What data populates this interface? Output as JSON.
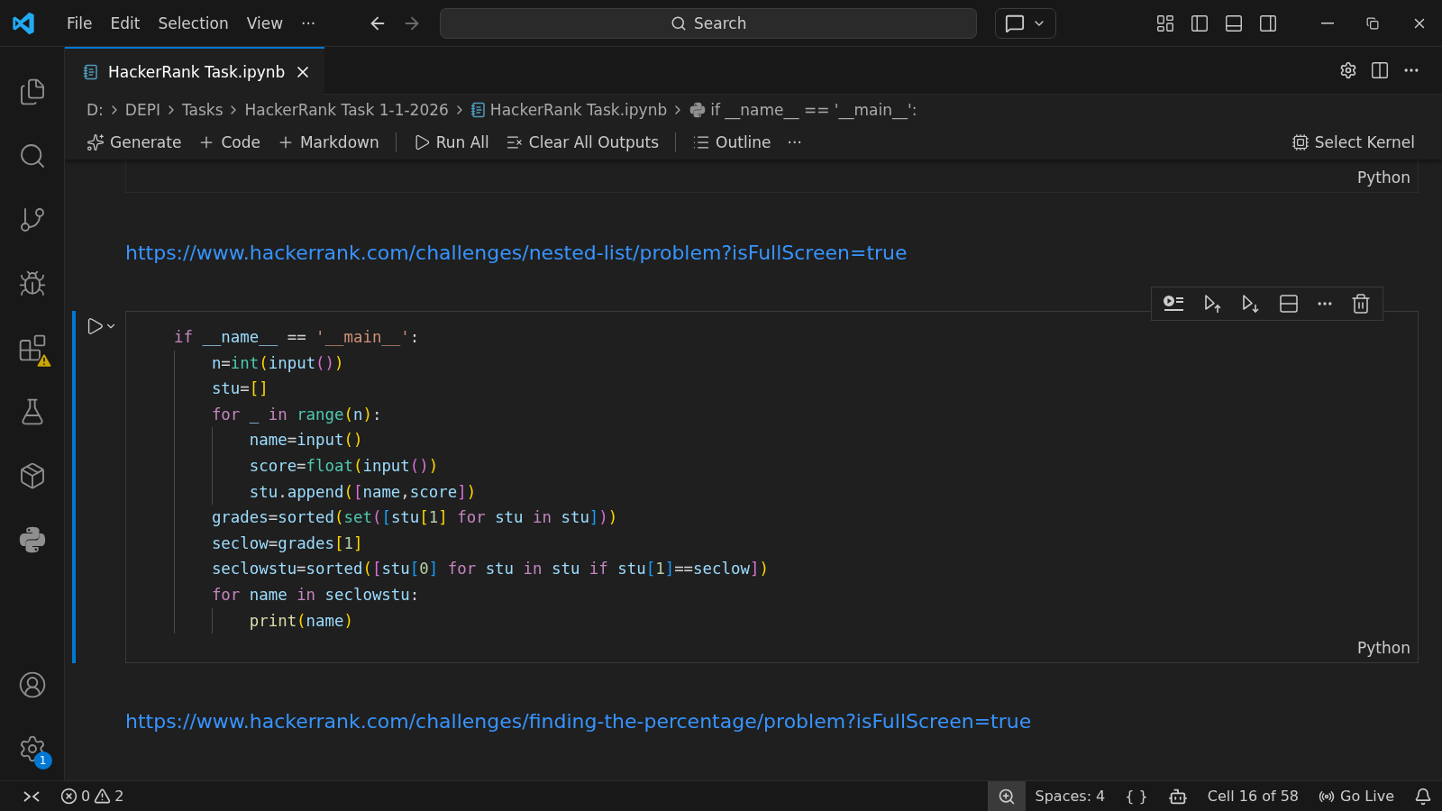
{
  "menu": [
    "File",
    "Edit",
    "Selection",
    "View",
    "···"
  ],
  "search": {
    "placeholder": "Search"
  },
  "activity_bar": [
    {
      "kind": "explorer",
      "warning": false
    },
    {
      "kind": "search",
      "warning": false
    },
    {
      "kind": "source-control",
      "warning": false
    },
    {
      "kind": "run",
      "warning": false
    },
    {
      "kind": "extensions",
      "warning": true
    },
    {
      "kind": "testing",
      "warning": false
    },
    {
      "kind": "package",
      "warning": false
    },
    {
      "kind": "python",
      "warning": false
    }
  ],
  "activity_bar_bottom": [
    {
      "kind": "account"
    },
    {
      "kind": "settings",
      "badge": "1"
    }
  ],
  "tabs": [
    {
      "label": "HackerRank Task.ipynb",
      "selected": true
    }
  ],
  "breadcrumbs": [
    {
      "label": "D:",
      "kind": "folder"
    },
    {
      "label": "DEPI",
      "kind": "folder"
    },
    {
      "label": "Tasks",
      "kind": "folder"
    },
    {
      "label": "HackerRank Task 1-1-2026",
      "kind": "folder"
    },
    {
      "label": "HackerRank Task.ipynb",
      "kind": "notebook"
    },
    {
      "label": "if __name__ == '__main__':",
      "kind": "python"
    }
  ],
  "toolbar": [
    {
      "label": "Generate",
      "kind": "sparkle"
    },
    {
      "label": "Code",
      "kind": "plus"
    },
    {
      "label": "Markdown",
      "kind": "plus"
    },
    {
      "kind": "divider"
    },
    {
      "label": "Run All",
      "kind": "run"
    },
    {
      "label": "Clear All Outputs",
      "kind": "clear"
    },
    {
      "kind": "divider"
    },
    {
      "label": "Outline",
      "kind": "list"
    },
    {
      "label": "···",
      "kind": "more"
    }
  ],
  "kernel": "Select Kernel",
  "cells": [
    {
      "kind": "code-tail",
      "language": "Python",
      "focused": false
    },
    {
      "kind": "markdown",
      "link": "https://www.hackerrank.com/challenges/nested-list/problem?isFullScreen=true"
    },
    {
      "kind": "code",
      "language": "Python",
      "focused": true,
      "lines": [
        {
          "tokens": [
            {
              "kind": "kw",
              "text": "if"
            },
            {
              "kind": "var",
              "text": " __name__"
            },
            {
              "kind": "p",
              "text": " == "
            },
            {
              "kind": "str",
              "text": "'__main__'"
            },
            {
              "kind": "p",
              "text": ":"
            }
          ],
          "children": [
            {
              "tokens": [
                {
                  "kind": "var",
                  "text": "n"
                },
                {
                  "kind": "p",
                  "text": "="
                },
                {
                  "kind": "cls",
                  "text": "int"
                },
                {
                  "kind": "b1",
                  "text": "("
                },
                {
                  "kind": "var",
                  "text": "input"
                },
                {
                  "kind": "b2",
                  "text": "()"
                },
                {
                  "kind": "b1",
                  "text": ")"
                }
              ]
            },
            {
              "tokens": [
                {
                  "kind": "var",
                  "text": "stu"
                },
                {
                  "kind": "p",
                  "text": "="
                },
                {
                  "kind": "b1",
                  "text": "[]"
                }
              ]
            },
            {
              "tokens": [
                {
                  "kind": "kw",
                  "text": "for"
                },
                {
                  "kind": "var",
                  "text": " _"
                },
                {
                  "kind": "kw",
                  "text": " in"
                },
                {
                  "kind": "cls",
                  "text": " range"
                },
                {
                  "kind": "b1",
                  "text": "("
                },
                {
                  "kind": "var",
                  "text": "n"
                },
                {
                  "kind": "b1",
                  "text": ")"
                },
                {
                  "kind": "p",
                  "text": ":"
                }
              ],
              "children": [
                {
                  "tokens": [
                    {
                      "kind": "var",
                      "text": "name"
                    },
                    {
                      "kind": "p",
                      "text": "="
                    },
                    {
                      "kind": "var",
                      "text": "input"
                    },
                    {
                      "kind": "b1",
                      "text": "()"
                    }
                  ]
                },
                {
                  "tokens": [
                    {
                      "kind": "var",
                      "text": "score"
                    },
                    {
                      "kind": "p",
                      "text": "="
                    },
                    {
                      "kind": "cls",
                      "text": "float"
                    },
                    {
                      "kind": "b1",
                      "text": "("
                    },
                    {
                      "kind": "var",
                      "text": "input"
                    },
                    {
                      "kind": "b2",
                      "text": "()"
                    },
                    {
                      "kind": "b1",
                      "text": ")"
                    }
                  ]
                },
                {
                  "tokens": [
                    {
                      "kind": "var",
                      "text": "stu"
                    },
                    {
                      "kind": "p",
                      "text": "."
                    },
                    {
                      "kind": "var",
                      "text": "append"
                    },
                    {
                      "kind": "b1",
                      "text": "("
                    },
                    {
                      "kind": "b2",
                      "text": "["
                    },
                    {
                      "kind": "var",
                      "text": "name"
                    },
                    {
                      "kind": "p",
                      "text": ","
                    },
                    {
                      "kind": "var",
                      "text": "score"
                    },
                    {
                      "kind": "b2",
                      "text": "]"
                    },
                    {
                      "kind": "b1",
                      "text": ")"
                    }
                  ]
                }
              ]
            },
            {
              "tokens": [
                {
                  "kind": "var",
                  "text": "grades"
                },
                {
                  "kind": "p",
                  "text": "="
                },
                {
                  "kind": "var",
                  "text": "sorted"
                },
                {
                  "kind": "b1",
                  "text": "("
                },
                {
                  "kind": "cls",
                  "text": "set"
                },
                {
                  "kind": "b2",
                  "text": "("
                },
                {
                  "kind": "b3",
                  "text": "["
                },
                {
                  "kind": "var",
                  "text": "stu"
                },
                {
                  "kind": "b1",
                  "text": "["
                },
                {
                  "kind": "num",
                  "text": "1"
                },
                {
                  "kind": "b1",
                  "text": "]"
                },
                {
                  "kind": "kw",
                  "text": " for"
                },
                {
                  "kind": "var",
                  "text": " stu"
                },
                {
                  "kind": "kw",
                  "text": " in"
                },
                {
                  "kind": "var",
                  "text": " stu"
                },
                {
                  "kind": "b3",
                  "text": "]"
                },
                {
                  "kind": "b2",
                  "text": ")"
                },
                {
                  "kind": "b1",
                  "text": ")"
                }
              ]
            },
            {
              "tokens": [
                {
                  "kind": "var",
                  "text": "seclow"
                },
                {
                  "kind": "p",
                  "text": "="
                },
                {
                  "kind": "var",
                  "text": "grades"
                },
                {
                  "kind": "b1",
                  "text": "["
                },
                {
                  "kind": "num",
                  "text": "1"
                },
                {
                  "kind": "b1",
                  "text": "]"
                }
              ]
            },
            {
              "tokens": [
                {
                  "kind": "var",
                  "text": "seclowstu"
                },
                {
                  "kind": "p",
                  "text": "="
                },
                {
                  "kind": "var",
                  "text": "sorted"
                },
                {
                  "kind": "b1",
                  "text": "("
                },
                {
                  "kind": "b2",
                  "text": "["
                },
                {
                  "kind": "var",
                  "text": "stu"
                },
                {
                  "kind": "b3",
                  "text": "["
                },
                {
                  "kind": "num",
                  "text": "0"
                },
                {
                  "kind": "b3",
                  "text": "]"
                },
                {
                  "kind": "kw",
                  "text": " for"
                },
                {
                  "kind": "var",
                  "text": " stu"
                },
                {
                  "kind": "kw",
                  "text": " in"
                },
                {
                  "kind": "var",
                  "text": " stu"
                },
                {
                  "kind": "kw",
                  "text": " if"
                },
                {
                  "kind": "var",
                  "text": " stu"
                },
                {
                  "kind": "b3",
                  "text": "["
                },
                {
                  "kind": "num",
                  "text": "1"
                },
                {
                  "kind": "b3",
                  "text": "]"
                },
                {
                  "kind": "p",
                  "text": "=="
                },
                {
                  "kind": "var",
                  "text": "seclow"
                },
                {
                  "kind": "b2",
                  "text": "]"
                },
                {
                  "kind": "b1",
                  "text": ")"
                }
              ]
            },
            {
              "tokens": [
                {
                  "kind": "kw",
                  "text": "for"
                },
                {
                  "kind": "var",
                  "text": " name"
                },
                {
                  "kind": "kw",
                  "text": " in"
                },
                {
                  "kind": "var",
                  "text": " seclowstu"
                },
                {
                  "kind": "p",
                  "text": ":"
                }
              ],
              "children": [
                {
                  "tokens": [
                    {
                      "kind": "fn",
                      "text": "print"
                    },
                    {
                      "kind": "b1",
                      "text": "("
                    },
                    {
                      "kind": "var",
                      "text": "name"
                    },
                    {
                      "kind": "b1",
                      "text": ")"
                    }
                  ]
                }
              ]
            }
          ]
        }
      ]
    },
    {
      "kind": "markdown",
      "link": "https://www.hackerrank.com/challenges/finding-the-percentage/problem?isFullScreen=true"
    }
  ],
  "status_bar": {
    "errors": "0",
    "warnings": "2",
    "items": [
      {
        "kind": "zoom",
        "highlighted": true
      },
      {
        "kind": "text",
        "label": "Spaces: 4",
        "highlighted": false
      },
      {
        "kind": "text",
        "label": "{ }",
        "highlighted": false
      },
      {
        "kind": "copilot",
        "highlighted": false
      },
      {
        "kind": "text",
        "label": "Cell 16 of 58",
        "highlighted": false
      },
      {
        "kind": "golive",
        "label": "Go Live",
        "highlighted": false
      },
      {
        "kind": "bell",
        "highlighted": false
      }
    ]
  }
}
